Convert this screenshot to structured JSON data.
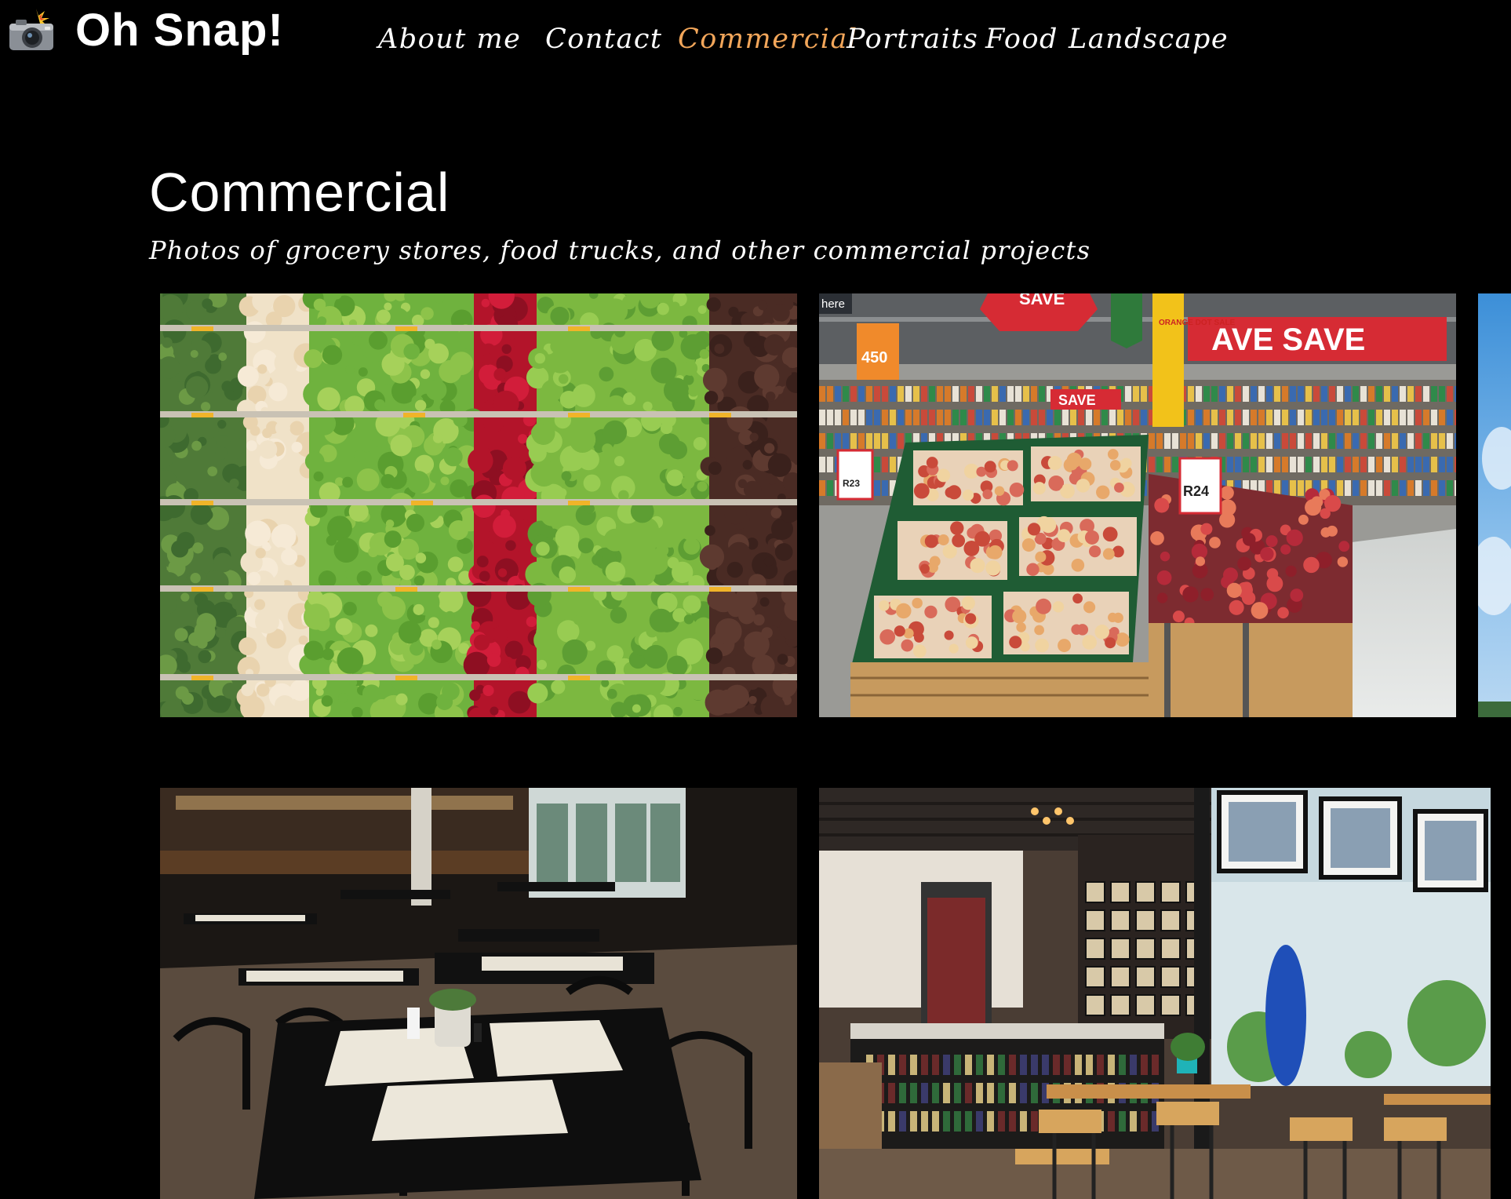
{
  "header": {
    "logo_icon": "camera-flash-icon",
    "site_title": "Oh Snap!",
    "nav": [
      {
        "label": "About me",
        "active": false
      },
      {
        "label": "Contact",
        "active": false
      },
      {
        "label": "Commercial",
        "active": true
      },
      {
        "label": "Portraits",
        "active": false
      },
      {
        "label": "Food",
        "active": false
      },
      {
        "label": "Landscape",
        "active": false
      }
    ]
  },
  "page": {
    "title": "Commercial",
    "subtitle": "Photos of grocery stores, food trucks, and other commercial projects"
  },
  "gallery": {
    "photos": [
      {
        "subject": "produce-shelves",
        "signs": []
      },
      {
        "subject": "supermarket-fruit-aisle",
        "signs": [
          "here",
          "450",
          "SAVE",
          "AVE",
          "ORANGE DOT SALE",
          "R23",
          "R24",
          "AVE SAVE"
        ]
      },
      {
        "subject": "sky-partial",
        "signs": []
      },
      {
        "subject": "dark-restaurant-tables",
        "signs": []
      },
      {
        "subject": "cafe-interior",
        "signs": []
      }
    ]
  },
  "colors": {
    "background": "#000000",
    "text": "#ffffff",
    "nav_active": "#f2a65a"
  }
}
